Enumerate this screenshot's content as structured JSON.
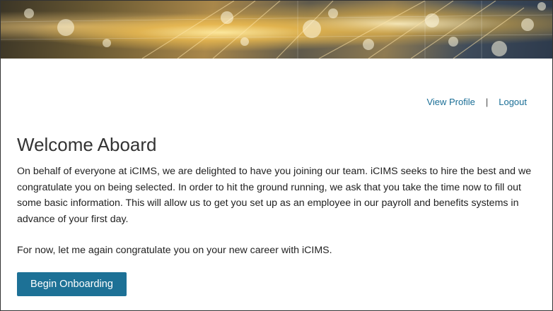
{
  "nav": {
    "view_profile": "View Profile",
    "separator": "|",
    "logout": "Logout"
  },
  "content": {
    "title": "Welcome Aboard",
    "paragraph_1": "On behalf of everyone at iCIMS, we are delighted to have you joining our team. iCIMS seeks to hire the best and we congratulate you on being selected.  In order to hit the ground running, we ask that you take the time now to fill out some basic information.  This will allow us to get you set up as an employee in our payroll and benefits systems in advance of your first day.",
    "paragraph_2": "For now, let me again congratulate you on your new career with iCIMS."
  },
  "actions": {
    "begin_label": "Begin Onboarding"
  },
  "colors": {
    "link": "#1a6e96",
    "button": "#1d7196",
    "text": "#222222"
  }
}
